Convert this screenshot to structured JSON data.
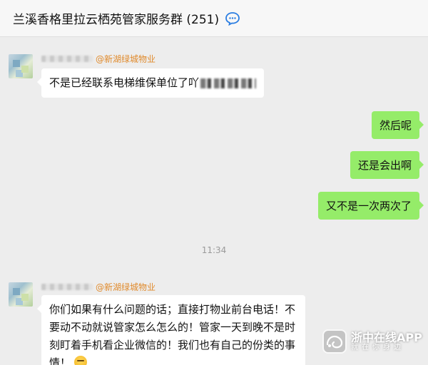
{
  "header": {
    "title": "兰溪香格里拉云栖苑管家服务群 (251)",
    "icon": "chat-bubble-icon"
  },
  "messages": [
    {
      "side": "left",
      "mention": "@新湖绿城物业",
      "text": "不是已经联系电梯维保单位了吖"
    },
    {
      "side": "right",
      "text": "然后呢"
    },
    {
      "side": "right",
      "text": "还是会出啊"
    },
    {
      "side": "right",
      "text": "又不是一次两次了"
    },
    {
      "side": "time",
      "text": "11:34"
    },
    {
      "side": "left",
      "mention": "@新湖绿城物业",
      "lines": [
        "你们如果有什么问题的话；直接打物业前台电话！不",
        "要动不动就说管家怎么怎么的！管家一天到晚不是时",
        "刻盯着手机看企业微信的！我们也有自己的份类的事",
        "情！"
      ]
    }
  ],
  "watermark": {
    "name": "浙中在线APP",
    "slogan": "就在你身边"
  },
  "colors": {
    "background": "#ededed",
    "right_bubble": "#95ec69",
    "left_bubble": "#ffffff",
    "mention": "#e08a2c"
  }
}
